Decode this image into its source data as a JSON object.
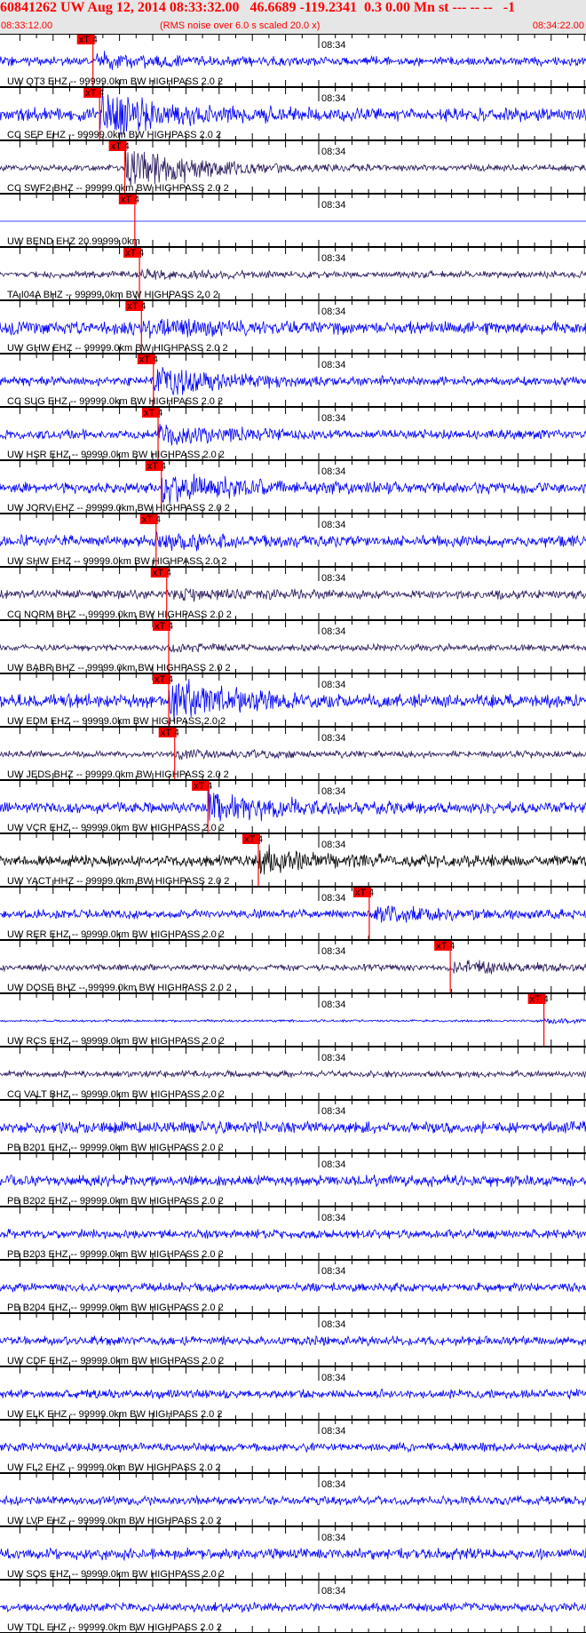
{
  "header": {
    "title": "60841262 UW Aug 12, 2014 08:33:32.00   46.6689 -119.2341  0.3 0.00 Mn st --- -- --   -1",
    "start_time": "08:33:12.00",
    "noise_note": "(RMS noise over 6.0 s scaled 20.0 x)",
    "end_time": "08:34:22.00",
    "color": "#ff0000"
  },
  "minute_label": "08:34",
  "pick_label": "xT 4",
  "colors": {
    "blue": "#0000ff",
    "navy": "#2b1a5c",
    "black": "#000000",
    "pick": "#ff0000"
  },
  "traces": [
    {
      "label": "UW QT3 EHZ -- 99999.0km BW  HIGHPASS  2.0  2",
      "color": "blue",
      "pick_s": 14.0
    },
    {
      "label": "CC SEP EHZ -- 99999.0km BW  HIGHPASS  2.0  2",
      "color": "blue",
      "pick_s": 15.0
    },
    {
      "label": "CC SWF2 BHZ -- 99999.0km BW  HIGHPASS  2.0  2",
      "color": "navy",
      "pick_s": 18.8
    },
    {
      "label": "UW BEND EHZ 20.99999.0km",
      "color": "blue",
      "pick_s": 20.3
    },
    {
      "label": "TA I04A BHZ -- 99999.0km BW  HIGHPASS  2.0  2",
      "color": "navy",
      "pick_s": 21.0
    },
    {
      "label": "UW GHW EHZ -- 99999.0km BW  HIGHPASS  2.0  2",
      "color": "blue",
      "pick_s": 21.3
    },
    {
      "label": "CC SUG EHZ -- 99999.0km BW  HIGHPASS  2.0  2",
      "color": "blue",
      "pick_s": 23.1
    },
    {
      "label": "UW HSR EHZ -- 99999.0km BW  HIGHPASS  2.0  2",
      "color": "blue",
      "pick_s": 23.8
    },
    {
      "label": "UW JORV EHZ -- 99999.0km BW  HIGHPASS  2.0  2",
      "color": "blue",
      "pick_s": 24.3
    },
    {
      "label": "UW SHW EHZ -- 99999.0km BW  HIGHPASS  2.0  2",
      "color": "blue",
      "pick_s": 23.5
    },
    {
      "label": "CC NORM BHZ -- 99999.0km BW  HIGHPASS  2.0  2",
      "color": "navy",
      "pick_s": 25.1
    },
    {
      "label": "UW BABR BHZ -- 99999.0km BW  HIGHPASS  2.0  2",
      "color": "navy",
      "pick_s": 25.4
    },
    {
      "label": "UW EDM EHZ -- 99999.0km BW  HIGHPASS  2.0  2",
      "color": "blue",
      "pick_s": 25.4
    },
    {
      "label": "UW JEDS BHZ -- 99999.0km BW  HIGHPASS  2.0  2",
      "color": "navy",
      "pick_s": 26.3
    },
    {
      "label": "UW VCR EHZ -- 99999.0km BW  HIGHPASS  2.0  2",
      "color": "blue",
      "pick_s": 31.3
    },
    {
      "label": "UW YACT HHZ -- 99999.0km BW  HIGHPASS  2.0  2",
      "color": "black",
      "pick_s": 38.9
    },
    {
      "label": "UW RER EHZ -- 99999.0km BW  HIGHPASS  2.0  2",
      "color": "blue",
      "pick_s": 55.6
    },
    {
      "label": "UW DOSE BHZ -- 99999.0km BW  HIGHPASS  2.0  2",
      "color": "navy",
      "pick_s": 67.8
    },
    {
      "label": "UW RCS EHZ -- 99999.0km BW  HIGHPASS  2.0  2",
      "color": "blue",
      "pick_s": 81.9
    },
    {
      "label": "CC VALT BHZ -- 99999.0km BW  HIGHPASS  2.0  2",
      "color": "navy",
      "pick_s": null
    },
    {
      "label": "PB B201 EHZ -- 99999.0km BW  HIGHPASS  2.0  2",
      "color": "blue",
      "pick_s": null
    },
    {
      "label": "PB B202 EHZ -- 99999.0km BW  HIGHPASS  2.0  2",
      "color": "blue",
      "pick_s": null
    },
    {
      "label": "PB B203 EHZ -- 99999.0km BW  HIGHPASS  2.0  2",
      "color": "blue",
      "pick_s": null
    },
    {
      "label": "PB B204 EHZ -- 99999.0km BW  HIGHPASS  2.0  2",
      "color": "blue",
      "pick_s": null
    },
    {
      "label": "UW CDF EHZ -- 99999.0km BW  HIGHPASS  2.0  2",
      "color": "blue",
      "pick_s": null
    },
    {
      "label": "UW ELK EHZ -- 99999.0km BW  HIGHPASS  2.0  2",
      "color": "blue",
      "pick_s": null
    },
    {
      "label": "UW FL2 EHZ -- 99999.0km BW  HIGHPASS  2.0  2",
      "color": "blue",
      "pick_s": null
    },
    {
      "label": "UW LVP EHZ -- 99999.0km BW  HIGHPASS  2.0  2",
      "color": "blue",
      "pick_s": null
    },
    {
      "label": "UW SOS EHZ -- 99999.0km BW  HIGHPASS  2.0  2",
      "color": "blue",
      "pick_s": null
    },
    {
      "label": "UW TDL EHZ -- 99999.0km BW  HIGHPASS  2.0  2",
      "color": "blue",
      "pick_s": null
    }
  ]
}
